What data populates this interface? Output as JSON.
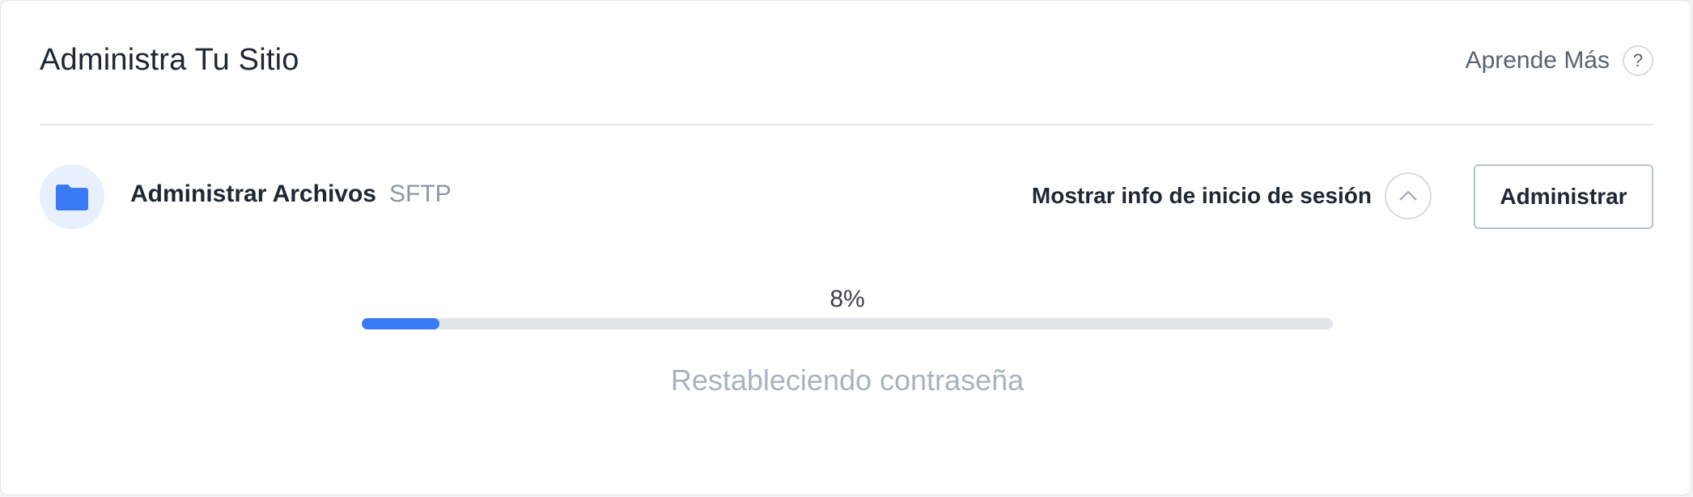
{
  "header": {
    "title": "Administra Tu Sitio",
    "learn_more_label": "Aprende Más",
    "help_icon_glyph": "?",
    "help_icon": "question-circle-icon"
  },
  "files_row": {
    "icon": "folder-icon",
    "title": "Administrar Archivos",
    "protocol": "SFTP",
    "show_login_label": "Mostrar info de inicio de sesión",
    "toggle_icon": "chevron-up-icon",
    "manage_label": "Administrar"
  },
  "progress": {
    "percent": 8,
    "label": "8%",
    "status": "Restableciendo contraseña"
  },
  "colors": {
    "accent": "#3b7af5",
    "folder_badge_bg": "#e8f0fd",
    "track": "#e2e5ea",
    "status_text": "#a7b3bf"
  }
}
